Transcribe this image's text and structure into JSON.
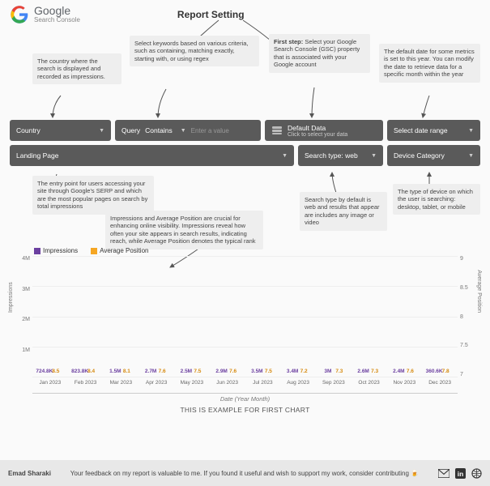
{
  "header": {
    "logo_text": "Google",
    "logo_sub": "Search Console",
    "title": "Report Setting"
  },
  "notes_top": {
    "country": "The country where the search is displayed and recorded as impressions.",
    "query": "Select keywords based on various criteria, such as containing, matching exactly, starting with, or using regex",
    "first_step": "First step: Select your Google Search Console (GSC) property that is associated with your Google account",
    "date": "The default date for some metrics is set to this year. You can modify the date to retrieve data for a specific month within the year"
  },
  "filters": {
    "country": "Country",
    "query": "Query",
    "query_op": "Contains",
    "query_placeholder": "Enter a value",
    "data_top": "Default Data",
    "data_sub": "Click to select your data",
    "date_range": "Select date range",
    "landing": "Landing Page",
    "search_type": "Search type:",
    "search_type_val": "web",
    "device": "Device Category"
  },
  "notes_bottom": {
    "landing": "The entry point for users accessing your site through Google's SERP and which are the most popular pages on search by total impressions",
    "chart": "Impressions and Average Position are crucial for enhancing online visibility. Impressions reveal how often your site appears in search results, indicating reach, while Average Position denotes the typical rank",
    "search_type": "Search type by default is web and results that appear are includes any image or video",
    "device": "The type of device on which the user is searching: desktop, tablet, or mobile"
  },
  "legend": {
    "impressions": "Impressions",
    "avg_position": "Average Position"
  },
  "colors": {
    "impressions": "#6b3fa0",
    "avg_position": "#f5a623"
  },
  "chart_data": {
    "type": "bar",
    "categories": [
      "Jan 2023",
      "Feb 2023",
      "Mar 2023",
      "Apr 2023",
      "May 2023",
      "Jun 2023",
      "Jul 2023",
      "Aug 2023",
      "Sep 2023",
      "Oct 2023",
      "Nov 2023",
      "Dec 2023"
    ],
    "series": [
      {
        "name": "Impressions",
        "values": [
          724800,
          823800,
          1500000,
          2700000,
          2500000,
          2900000,
          3500000,
          3400000,
          3000000,
          2600000,
          2400000,
          360600
        ],
        "labels": [
          "724.8K",
          "823.8K",
          "1.5M",
          "2.7M",
          "2.5M",
          "2.9M",
          "3.5M",
          "3.4M",
          "3M",
          "2.6M",
          "2.4M",
          "360.6K"
        ],
        "ylim": [
          0,
          4000000
        ],
        "yticks": [
          "4M",
          "3M",
          "2M",
          "1M",
          ""
        ]
      },
      {
        "name": "Average Position",
        "values": [
          8.5,
          8.4,
          8.1,
          7.6,
          7.5,
          7.6,
          7.5,
          7.2,
          7.3,
          7.3,
          7.6,
          7.8
        ],
        "labels": [
          "8.5",
          "8.4",
          "8.1",
          "7.6",
          "7.5",
          "7.6",
          "7.5",
          "7.2",
          "7.3",
          "7.3",
          "7.6",
          "7.8"
        ],
        "ylim": [
          7,
          9
        ],
        "yticks": [
          "9",
          "8.5",
          "8",
          "7.5",
          "7"
        ]
      }
    ],
    "xlabel": "Date (Year Month)",
    "ylabel_left": "Impressions",
    "ylabel_right": "Average Position",
    "caption": "THIS IS EXAMPLE FOR FIRST CHART"
  },
  "footer": {
    "credit": "Emad Sharaki",
    "message": "Your feedback on my report is valuable to me. If you found it useful and wish to support my work, consider contributing"
  }
}
